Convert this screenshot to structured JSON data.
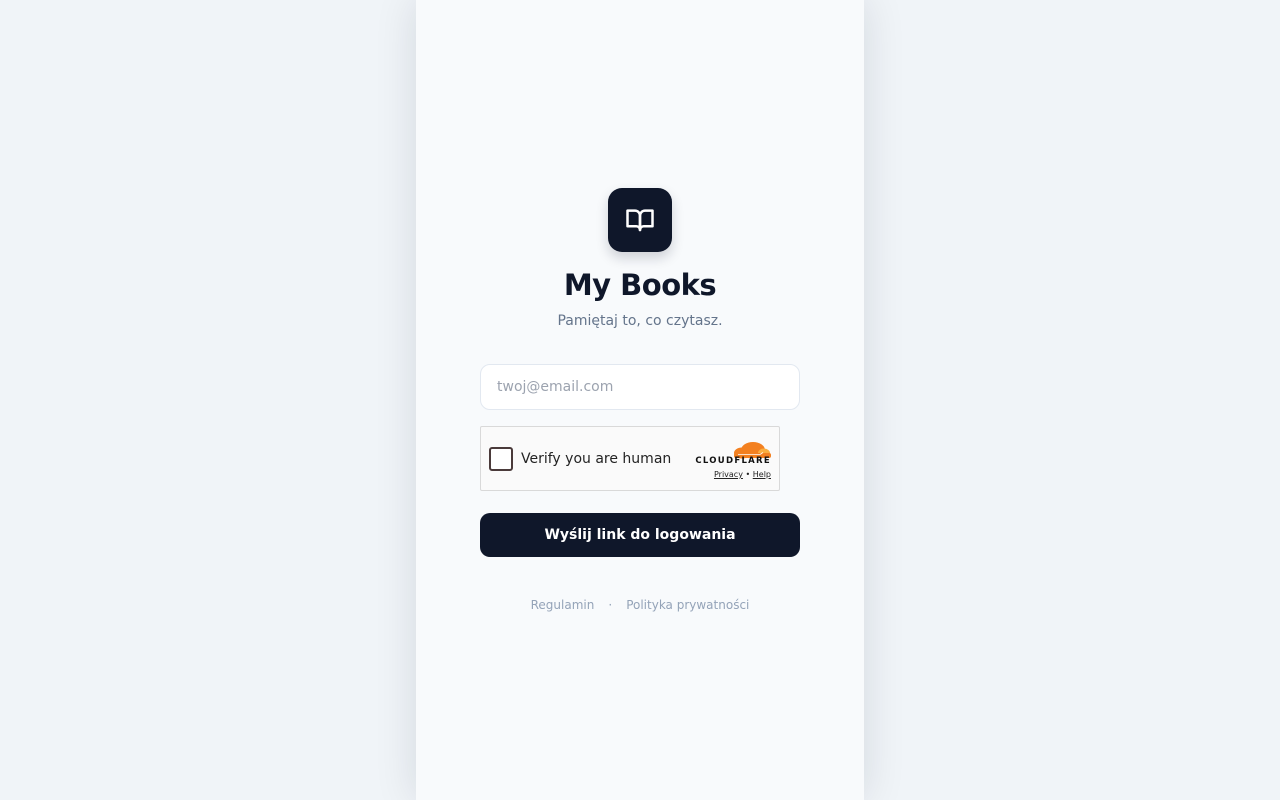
{
  "app": {
    "title": "My Books",
    "tagline": "Pamiętaj to, co czytasz."
  },
  "form": {
    "email_placeholder": "twoj@email.com",
    "email_value": "",
    "submit_label": "Wyślij link do logowania"
  },
  "captcha": {
    "label": "Verify you are human",
    "brand": "CLOUDFLARE",
    "privacy_label": "Privacy",
    "separator": "•",
    "help_label": "Help",
    "brand_color": "#f38020"
  },
  "footer": {
    "terms_label": "Regulamin",
    "separator": "·",
    "privacy_label": "Polityka prywatności"
  },
  "colors": {
    "primary": "#0f172a",
    "muted": "#64748b",
    "background": "#f8fafc"
  },
  "icons": {
    "logo": "open-book-icon",
    "captcha_logo": "cloudflare-cloud-icon"
  }
}
